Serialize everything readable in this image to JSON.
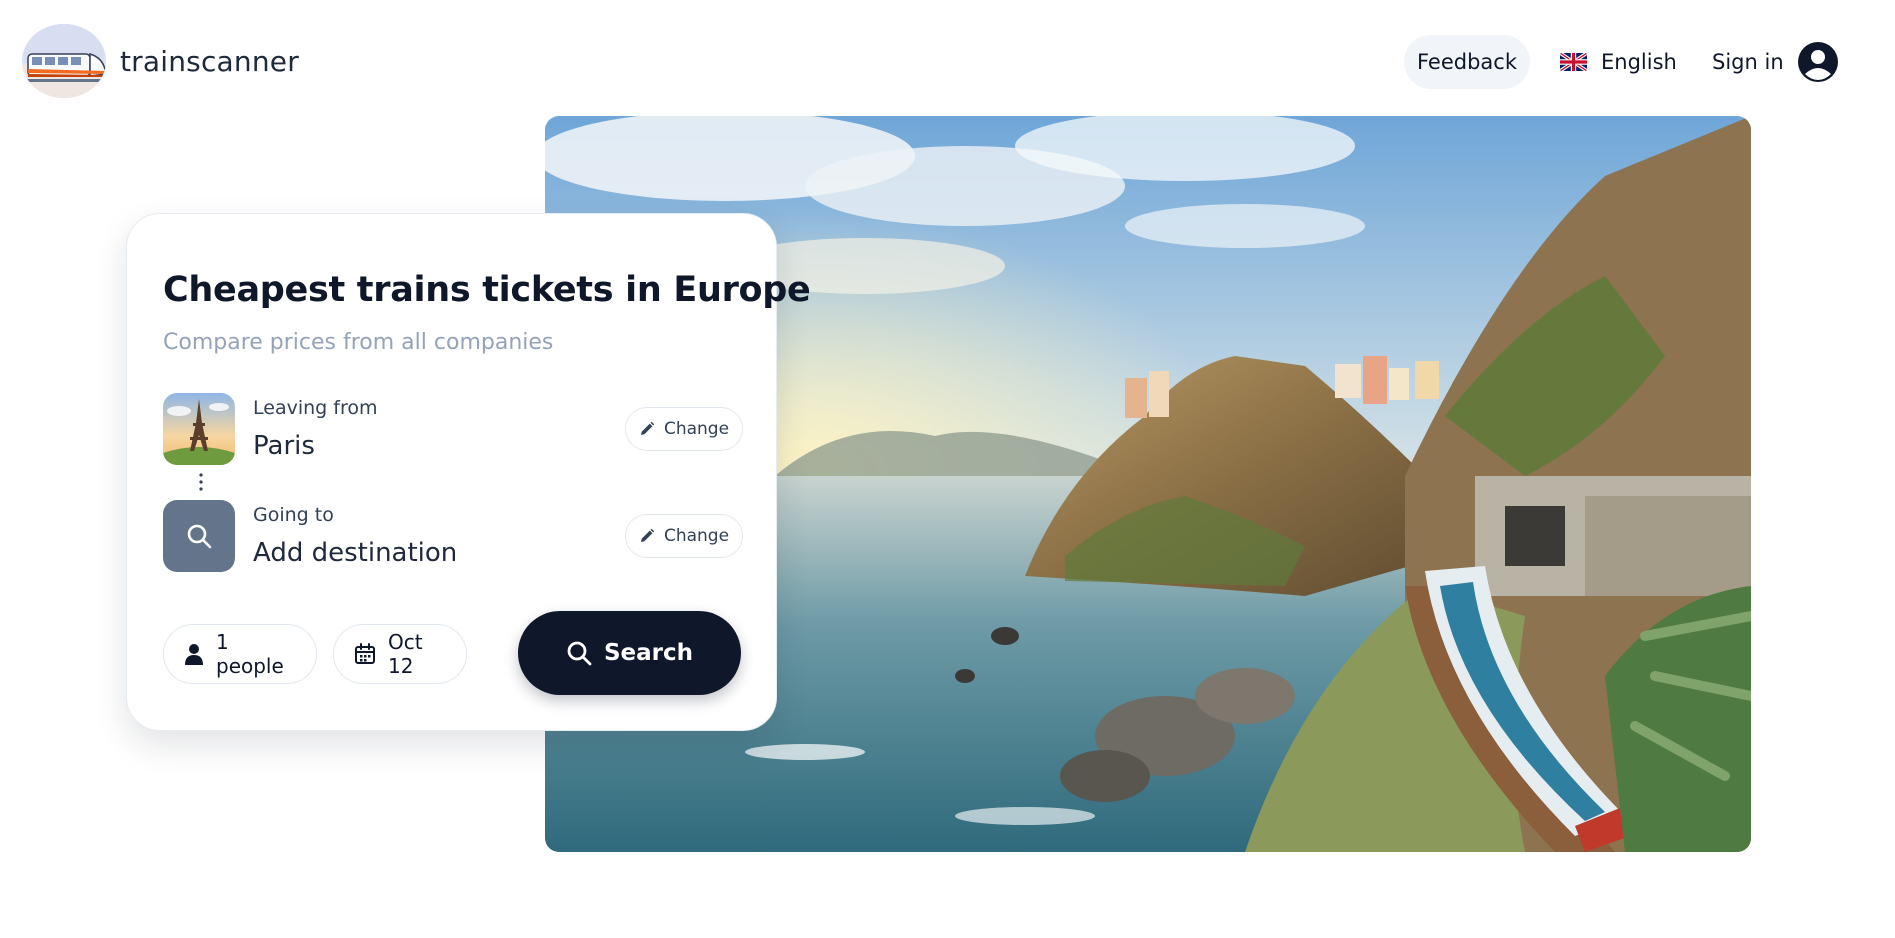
{
  "header": {
    "brand": "trainscanner",
    "feedback_label": "Feedback",
    "language_label": "English",
    "signin_label": "Sign in"
  },
  "search_card": {
    "title": "Cheapest trains tickets in Europe",
    "subtitle": "Compare prices from all companies",
    "from": {
      "label": "Leaving from",
      "value": "Paris",
      "change_label": "Change",
      "icon": "eiffel-tower-thumbnail"
    },
    "to": {
      "label": "Going to",
      "value": "Add destination",
      "change_label": "Change",
      "icon": "search-icon"
    },
    "passengers_label": "1 people",
    "date_label": "Oct 12",
    "search_label": "Search"
  },
  "colors": {
    "primary_dark": "#0f172a",
    "muted_text": "#94a3b8",
    "thumb_slate": "#64748b",
    "feedback_bg": "#f1f5f9"
  },
  "hero": {
    "description_icon": "coastal-train-photo"
  }
}
